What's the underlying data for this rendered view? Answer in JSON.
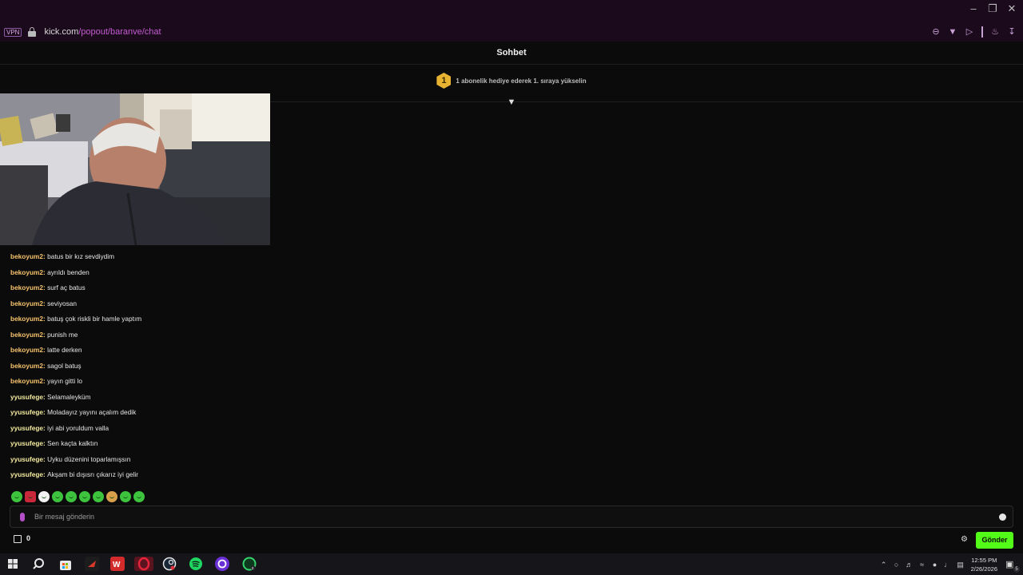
{
  "browser": {
    "vpn_label": "VPN",
    "url_host": "kick.com",
    "url_path": "/popout/baranve/chat",
    "window_controls": [
      "minimize-icon",
      "restore-icon",
      "close-icon"
    ],
    "toolbar_icons": [
      "zoom-out-icon",
      "pocket-icon",
      "send-icon",
      "extensions-icon",
      "download-icon"
    ]
  },
  "chat": {
    "title": "Sohbet",
    "gift_rank": "1",
    "gift_text": "1 abonelik hediye ederek 1. sıraya yükselin",
    "messages": [
      {
        "user": "bekoyum2",
        "color": "#f6c26b",
        "text": "batus bir kız sevdiydim"
      },
      {
        "user": "bekoyum2",
        "color": "#f6c26b",
        "text": "ayrıldı benden"
      },
      {
        "user": "bekoyum2",
        "color": "#f6c26b",
        "text": "surf aç batus"
      },
      {
        "user": "bekoyum2",
        "color": "#f6c26b",
        "text": "seviyosan"
      },
      {
        "user": "bekoyum2",
        "color": "#f6c26b",
        "text": "batuş çok riskli bir hamle yaptım"
      },
      {
        "user": "bekoyum2",
        "color": "#f6c26b",
        "text": "punish me"
      },
      {
        "user": "bekoyum2",
        "color": "#f6c26b",
        "text": "latte derken"
      },
      {
        "user": "bekoyum2",
        "color": "#f6c26b",
        "text": "sagol batuş"
      },
      {
        "user": "bekoyum2",
        "color": "#f6c26b",
        "text": "yayın gitti lo"
      },
      {
        "user": "yyusufege",
        "color": "#f3ea9e",
        "text": "Selamaleyküm"
      },
      {
        "user": "yyusufege",
        "color": "#f3ea9e",
        "text": "Moladayız yayını açalım dedik"
      },
      {
        "user": "yyusufege",
        "color": "#f3ea9e",
        "text": "iyi abi yoruldum valla"
      },
      {
        "user": "yyusufege",
        "color": "#f3ea9e",
        "text": "Sen kaçta kalktın"
      },
      {
        "user": "yyusufege",
        "color": "#f3ea9e",
        "text": "Uyku düzenini toparlamışsın"
      },
      {
        "user": "yyusufege",
        "color": "#f3ea9e",
        "text": "Akşam bi dışısrı çıkarız iyi gelir"
      }
    ],
    "emotes": [
      "frog-emote",
      "red-emote",
      "panda-emote",
      "frog-emote",
      "frog-emote",
      "frog-emote",
      "frog-emote",
      "face-emote",
      "frog-emote",
      "frog-emote"
    ],
    "input_placeholder": "Bir mesaj gönderin",
    "gift_count": "0",
    "send_label": "Gönder",
    "accent_color": "#53fc18"
  },
  "taskbar": {
    "apps": [
      "start-icon",
      "search-icon",
      "store-icon",
      "app-red-icon",
      "wps-icon",
      "opera-icon",
      "steam-icon",
      "spotify-icon",
      "app-circle-icon",
      "whatsapp-icon"
    ],
    "time": "12:55 PM",
    "date": "2/26/2026",
    "notification_count": "5"
  }
}
